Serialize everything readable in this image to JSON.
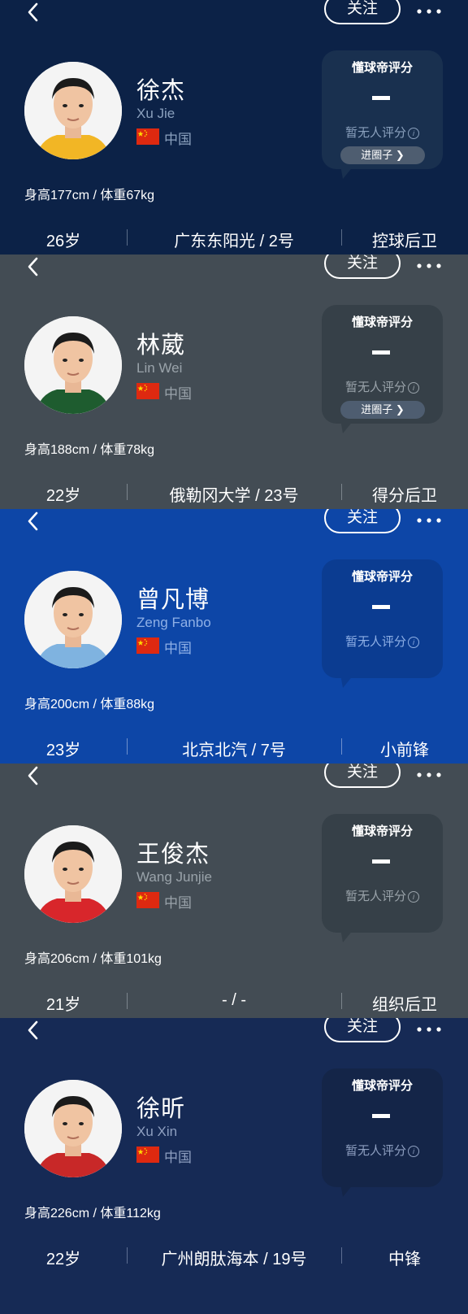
{
  "common": {
    "follow_label": "关注",
    "rating_title": "懂球帝评分",
    "rating_empty": "暂无人评分",
    "circle_label": "进圈子",
    "country": "中国"
  },
  "cards": [
    {
      "name": "徐杰",
      "pinyin": "Xu Jie",
      "stats": "身高177cm / 体重67kg",
      "age": "26岁",
      "team": "广东东阳光 / 2号",
      "position": "控球后卫",
      "bg": "#0c2247",
      "rating_bg": "#19304f",
      "muted": "#8aa0bd",
      "sep": "#5a6c88",
      "jersey": "#f2b625",
      "show_circle": true
    },
    {
      "name": "林葳",
      "pinyin": "Lin Wei",
      "stats": "身高188cm / 体重78kg",
      "age": "22岁",
      "team": "俄勒冈大学 / 23号",
      "position": "得分后卫",
      "bg": "#434c54",
      "rating_bg": "#364048",
      "muted": "#9aa3aa",
      "sep": "#7c858c",
      "jersey": "#1e5c2f",
      "show_circle": true
    },
    {
      "name": "曾凡博",
      "pinyin": "Zeng Fanbo",
      "stats": "身高200cm / 体重88kg",
      "age": "23岁",
      "team": "北京北汽 / 7号",
      "position": "小前锋",
      "bg": "#0d46a7",
      "rating_bg": "#0b3c91",
      "muted": "#8fb0e6",
      "sep": "#6f90cc",
      "jersey": "#7fb3e0",
      "show_circle": false
    },
    {
      "name": "王俊杰",
      "pinyin": "Wang Junjie",
      "stats": "身高206cm / 体重101kg",
      "age": "21岁",
      "team": "- / -",
      "position": "组织后卫",
      "bg": "#434c54",
      "rating_bg": "#364048",
      "muted": "#9aa3aa",
      "sep": "#7c858c",
      "jersey": "#d8262b",
      "show_circle": false
    },
    {
      "name": "徐昕",
      "pinyin": "Xu Xin",
      "stats": "身高226cm / 体重112kg",
      "age": "22岁",
      "team": "广州朗肽海本 / 19号",
      "position": "中锋",
      "bg": "#162a55",
      "rating_bg": "#142548",
      "muted": "#8e9fc0",
      "sep": "#5d6e92",
      "jersey": "#c82828",
      "show_circle": false
    }
  ]
}
